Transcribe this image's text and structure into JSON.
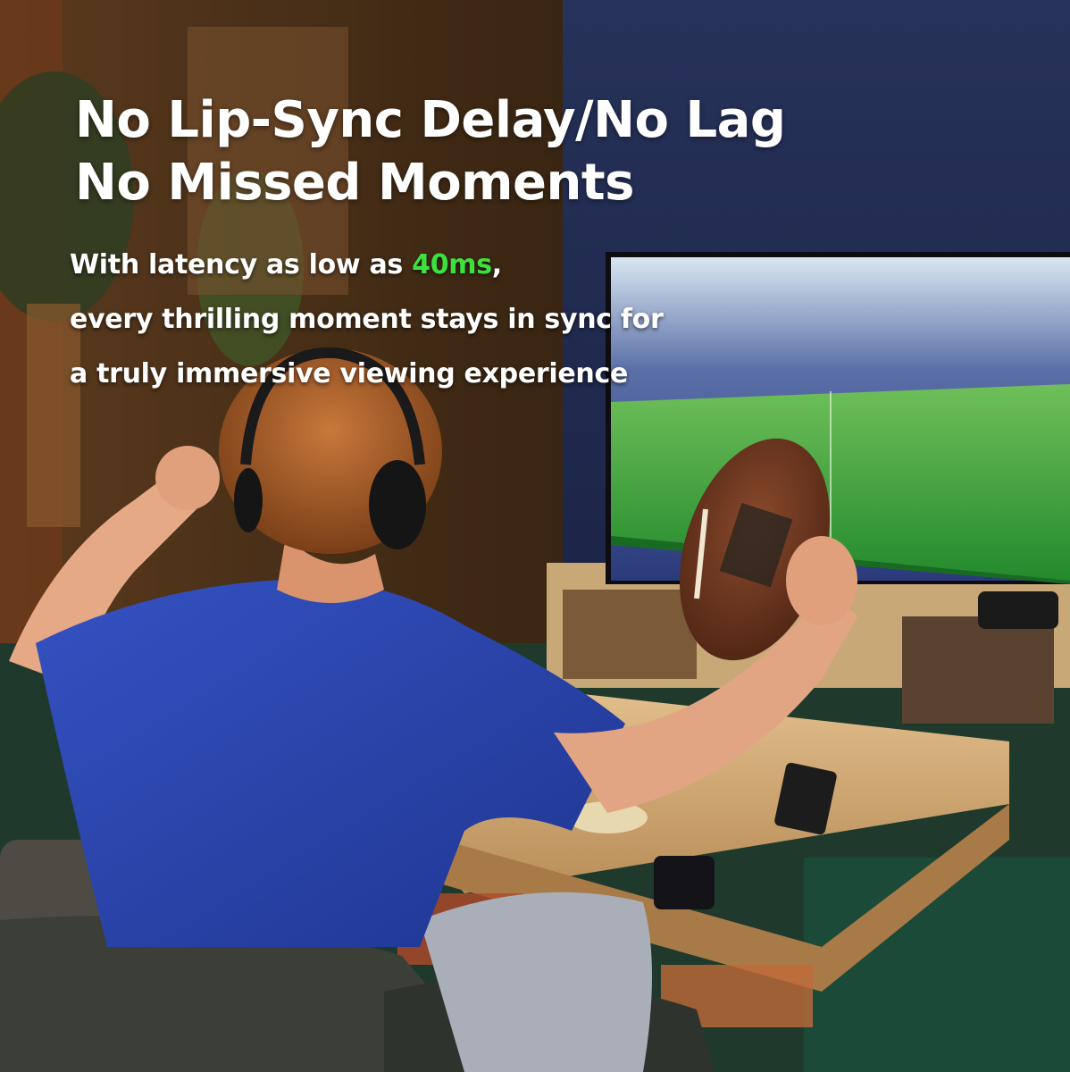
{
  "headline": {
    "line1": "No Lip-Sync Delay/No Lag",
    "line2": "No Missed Moments"
  },
  "subtext": {
    "line1_before": "With latency as low as ",
    "latency_value": "40ms",
    "line1_after": ",",
    "line2": "every thrilling moment stays in sync for",
    "line3": "a truly immersive viewing experience"
  },
  "colors": {
    "accent": "#3ee03e",
    "text": "#ffffff",
    "tv_field": "#2f9a34",
    "shirt": "#2a47b0"
  },
  "scene": {
    "description_icons": [
      "headphones-icon",
      "football-icon",
      "tv-icon",
      "remote-icon",
      "phone-icon"
    ]
  }
}
